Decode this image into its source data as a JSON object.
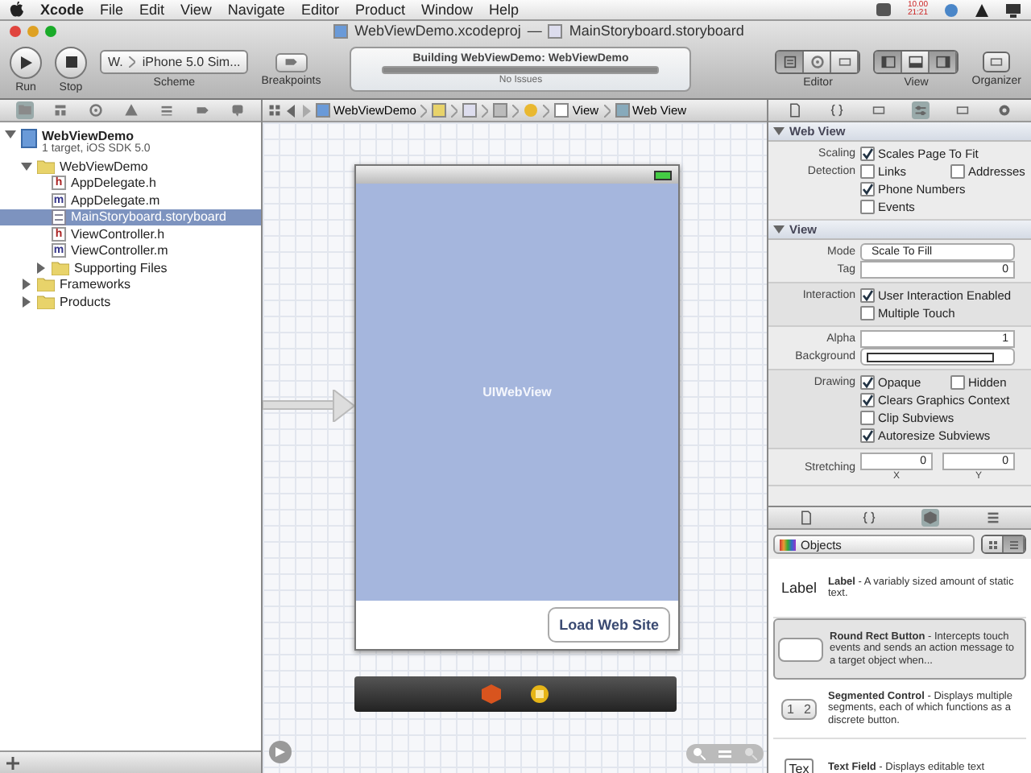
{
  "menu_bar": {
    "app": "Xcode",
    "items": [
      "File",
      "Edit",
      "View",
      "Navigate",
      "Editor",
      "Product",
      "Window",
      "Help"
    ],
    "clock": [
      "10.00",
      "21:21"
    ]
  },
  "window": {
    "project": "WebViewDemo.xcodeproj",
    "separator": "—",
    "file": "MainStoryboard.storyboard"
  },
  "toolbar": {
    "run": "Run",
    "stop": "Stop",
    "scheme_target": "W.",
    "scheme_device": "iPhone 5.0 Sim...",
    "scheme_label": "Scheme",
    "breakpoints": "Breakpoints",
    "activity": {
      "title": "Building WebViewDemo: WebViewDemo",
      "level": 1,
      "status": "No Issues"
    },
    "editor_label": "Editor",
    "editor_modes": [
      {
        "selected": true
      },
      {
        "selected": false
      },
      {
        "selected": false
      }
    ],
    "view_label": "View",
    "view_toggles": [
      {
        "on": true
      },
      {
        "on": false
      },
      {
        "on": true
      }
    ],
    "organizer": "Organizer"
  },
  "navigator": {
    "tabs": [
      {
        "selected": true
      },
      {
        "selected": false
      },
      {
        "selected": false
      },
      {
        "selected": false
      },
      {
        "selected": false
      },
      {
        "selected": false
      },
      {
        "selected": false
      }
    ],
    "project": {
      "name": "WebViewDemo",
      "subtitle": "1 target, iOS SDK 5.0",
      "expanded": true
    },
    "tree": [
      {
        "name": "WebViewDemo",
        "kind": "folder",
        "expanded": true,
        "selected": false,
        "children": [
          {
            "name": "AppDelegate.h",
            "kind": "source",
            "letter": "h",
            "selected": false
          },
          {
            "name": "AppDelegate.m",
            "kind": "source",
            "letter": "m",
            "selected": false
          },
          {
            "name": "MainStoryboard.storyboard",
            "kind": "storyboard",
            "selected": true
          },
          {
            "name": "ViewController.h",
            "kind": "source",
            "letter": "h",
            "selected": false
          },
          {
            "name": "ViewController.m",
            "kind": "source",
            "letter": "m",
            "selected": false
          },
          {
            "name": "Supporting Files",
            "kind": "folder",
            "expanded": false,
            "selected": false
          }
        ]
      },
      {
        "name": "Frameworks",
        "kind": "folder",
        "expanded": false,
        "selected": false
      },
      {
        "name": "Products",
        "kind": "folder",
        "expanded": false,
        "selected": false
      }
    ]
  },
  "jump_bar": [
    {
      "kind": "project",
      "label": "WebViewDemo"
    },
    {
      "kind": "folder"
    },
    {
      "kind": "file"
    },
    {
      "kind": "scene"
    },
    {
      "kind": "controller"
    },
    {
      "kind": "view",
      "label": "View"
    },
    {
      "kind": "webview",
      "label": "Web View"
    }
  ],
  "canvas": {
    "scene": {
      "view_label": "UIWebView",
      "button": "Load Web Site"
    }
  },
  "inspector": {
    "tabs": [
      {
        "selected": false
      },
      {
        "selected": false
      },
      {
        "selected": false
      },
      {
        "selected": true
      },
      {
        "selected": false
      },
      {
        "selected": false
      }
    ],
    "sections": [
      {
        "title": "Web View",
        "expanded": true,
        "groups": [
          {
            "shaded": false,
            "rows": [
              {
                "kind": "checks",
                "label": "Scaling",
                "checks": [
                  {
                    "label": "Scales Page To Fit",
                    "checked": true
                  }
                ]
              },
              {
                "kind": "checks",
                "label": "Detection",
                "checks": [
                  {
                    "label": "Links",
                    "checked": false
                  },
                  {
                    "label": "Addresses",
                    "checked": false
                  }
                ]
              },
              {
                "kind": "checks",
                "checks": [
                  {
                    "label": "Phone Numbers",
                    "checked": true
                  }
                ]
              },
              {
                "kind": "checks",
                "checks": [
                  {
                    "label": "Events",
                    "checked": false
                  }
                ]
              }
            ]
          }
        ]
      },
      {
        "title": "View",
        "expanded": true,
        "groups": [
          {
            "shaded": false,
            "rows": [
              {
                "kind": "select",
                "label": "Mode",
                "value": "Scale To Fill"
              },
              {
                "kind": "stepper",
                "label": "Tag",
                "value": "0"
              }
            ]
          },
          {
            "shaded": true,
            "rows": [
              {
                "kind": "checks",
                "label": "Interaction",
                "checks": [
                  {
                    "label": "User Interaction Enabled",
                    "checked": true
                  }
                ]
              },
              {
                "kind": "checks",
                "checks": [
                  {
                    "label": "Multiple Touch",
                    "checked": false
                  }
                ]
              }
            ]
          },
          {
            "shaded": false,
            "rows": [
              {
                "kind": "stepper",
                "label": "Alpha",
                "value": "1"
              },
              {
                "kind": "color",
                "label": "Background"
              }
            ]
          },
          {
            "shaded": true,
            "rows": [
              {
                "kind": "checks",
                "label": "Drawing",
                "checks": [
                  {
                    "label": "Opaque",
                    "checked": true
                  },
                  {
                    "label": "Hidden",
                    "checked": false
                  }
                ]
              },
              {
                "kind": "checks",
                "checks": [
                  {
                    "label": "Clears Graphics Context",
                    "checked": true
                  }
                ]
              },
              {
                "kind": "checks",
                "checks": [
                  {
                    "label": "Clip Subviews",
                    "checked": false
                  }
                ]
              },
              {
                "kind": "checks",
                "checks": [
                  {
                    "label": "Autoresize Subviews",
                    "checked": true
                  }
                ]
              }
            ]
          },
          {
            "shaded": false,
            "rows": [
              {
                "kind": "pair",
                "label": "Stretching",
                "fields": [
                  {
                    "value": "0",
                    "caption": "X"
                  },
                  {
                    "value": "0",
                    "caption": "Y"
                  }
                ]
              }
            ]
          }
        ]
      }
    ]
  },
  "library": {
    "tabs": [
      {
        "selected": false
      },
      {
        "selected": false
      },
      {
        "selected": true
      },
      {
        "selected": false
      }
    ],
    "filter": "Objects",
    "view_modes": [
      {
        "selected": false
      },
      {
        "selected": true
      }
    ],
    "items": [
      {
        "kind": "label",
        "preview": "Label",
        "text": "**Label** - A variably sized amount of static text.",
        "selected": false
      },
      {
        "kind": "button",
        "text": "**Round Rect Button** - Intercepts touch events and sends an action message to a target object when...",
        "selected": true
      },
      {
        "kind": "segmented",
        "segments": [
          "1",
          "2"
        ],
        "text": "**Segmented Control** - Displays multiple segments, each of which functions as a discrete button.",
        "selected": false
      },
      {
        "kind": "textfield",
        "preview": "Tex",
        "text": "**Text Field** - Displays editable text",
        "selected": false
      }
    ]
  }
}
